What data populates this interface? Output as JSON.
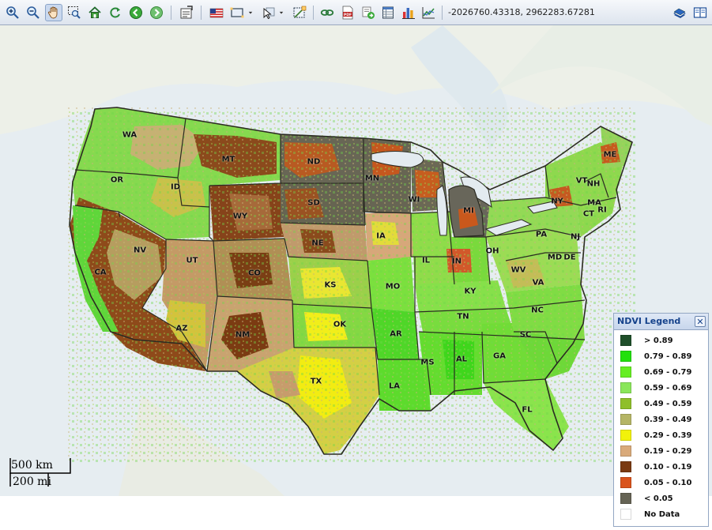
{
  "toolbar": {
    "coordinates": "-2026760.43318, 2962283.67281",
    "tools": [
      {
        "name": "zoom-in-icon"
      },
      {
        "name": "zoom-out-icon"
      },
      {
        "name": "pan-hand-icon"
      },
      {
        "name": "zoom-to-box-icon"
      },
      {
        "name": "home-extent-icon"
      },
      {
        "name": "refresh-icon"
      },
      {
        "name": "back-icon"
      },
      {
        "name": "forward-icon"
      },
      {
        "name": "identify-icon"
      },
      {
        "name": "us-flag-icon"
      },
      {
        "name": "select-box-icon"
      },
      {
        "name": "select-dropdown-icon"
      },
      {
        "name": "select-arrow-icon"
      },
      {
        "name": "select-arrow-dropdown-icon"
      },
      {
        "name": "clear-selection-icon"
      },
      {
        "name": "link-icon"
      },
      {
        "name": "pdf-icon"
      },
      {
        "name": "export-icon"
      },
      {
        "name": "table-icon"
      },
      {
        "name": "bar-chart-icon"
      },
      {
        "name": "line-chart-icon"
      },
      {
        "name": "book-blue-icon"
      },
      {
        "name": "book-open-icon"
      }
    ]
  },
  "map": {
    "states": [
      "WA",
      "OR",
      "CA",
      "NV",
      "ID",
      "MT",
      "WY",
      "UT",
      "AZ",
      "CO",
      "NM",
      "ND",
      "SD",
      "NE",
      "KS",
      "OK",
      "TX",
      "MN",
      "IA",
      "MO",
      "AR",
      "LA",
      "WI",
      "IL",
      "MI",
      "IN",
      "OH",
      "KY",
      "TN",
      "MS",
      "AL",
      "GA",
      "FL",
      "SC",
      "NC",
      "VA",
      "WV",
      "PA",
      "NY",
      "VT",
      "NH",
      "ME",
      "MA",
      "CT",
      "RI",
      "NJ",
      "MD",
      "DE"
    ],
    "scale": {
      "km": "500 km",
      "mi": "200 mi"
    }
  },
  "legend": {
    "title": "NDVI Legend",
    "close": "✕",
    "items": [
      {
        "label": "> 0.89",
        "color": "#1f4f2a"
      },
      {
        "label": "0.79 - 0.89",
        "color": "#22e00c"
      },
      {
        "label": "0.69 - 0.79",
        "color": "#66ee22"
      },
      {
        "label": "0.59 - 0.69",
        "color": "#8ae65a"
      },
      {
        "label": "0.49 - 0.59",
        "color": "#8fbf2a"
      },
      {
        "label": "0.39 - 0.49",
        "color": "#b5b565"
      },
      {
        "label": "0.29 - 0.39",
        "color": "#f2f20a"
      },
      {
        "label": "0.19 - 0.29",
        "color": "#d9aa7a"
      },
      {
        "label": "0.10 - 0.19",
        "color": "#7a3a12"
      },
      {
        "label": "0.05 - 0.10",
        "color": "#d9531c"
      },
      {
        "label": "< 0.05",
        "color": "#656354"
      },
      {
        "label": "No Data",
        "color": "#ffffff"
      }
    ]
  }
}
